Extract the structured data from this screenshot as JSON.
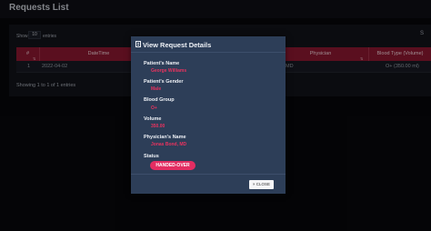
{
  "page": {
    "title": "Requests List"
  },
  "table_controls": {
    "show_label": "Show",
    "length_value": "10",
    "entries_label": "entries",
    "search_edge": "S"
  },
  "table": {
    "headers": [
      {
        "label": "#"
      },
      {
        "label": "DateTime"
      },
      {
        "label": "Physician"
      },
      {
        "label": "Blood Type (Volume)"
      }
    ],
    "rows": [
      {
        "num": "1",
        "datetime": "2022-04-02",
        "physician_fragment": "MD",
        "blood_type": "O+ (350.00 ml)"
      }
    ],
    "info": "Showing 1 to 1 of 1 entries"
  },
  "modal": {
    "title": "View Request Details",
    "fields": [
      {
        "label": "Patient's Name",
        "value": "George Williams"
      },
      {
        "label": "Patient's Gender",
        "value": "Male"
      },
      {
        "label": "Blood Group",
        "value": "O+"
      },
      {
        "label": "Volume",
        "value": "350.00"
      },
      {
        "label": "Physician's Name",
        "value": "Jonas Bond, MD"
      }
    ],
    "status_label": "Status",
    "status_value": "HANDED-OVER",
    "close_label": "× CLOSE"
  },
  "colors": {
    "accent": "#e8335f",
    "header_bg": "#8b1731",
    "modal_bg": "#2d3e58"
  }
}
